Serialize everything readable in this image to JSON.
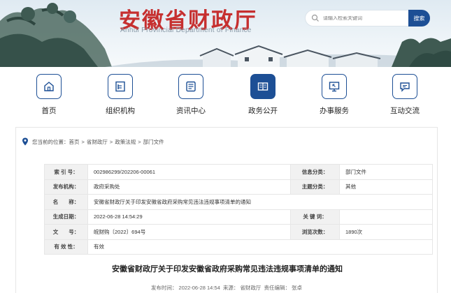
{
  "header": {
    "title": "安徽省财政厅",
    "subtitle": "Anhui Provincial Department of Finance",
    "search_placeholder": "请输入检索关键词",
    "search_button": "搜索"
  },
  "nav": {
    "items": [
      {
        "label": "首页",
        "icon": "home-icon",
        "active": false
      },
      {
        "label": "组织机构",
        "icon": "org-icon",
        "active": false
      },
      {
        "label": "资讯中心",
        "icon": "news-icon",
        "active": false
      },
      {
        "label": "政务公开",
        "icon": "book-icon",
        "active": true
      },
      {
        "label": "办事服务",
        "icon": "monitor-icon",
        "active": false
      },
      {
        "label": "互动交流",
        "icon": "chat-icon",
        "active": false
      }
    ]
  },
  "breadcrumb": {
    "prefix": "您当前的位置：",
    "items": [
      "首页",
      "省财政厅",
      "政策法规",
      "部门文件"
    ],
    "separator": ">"
  },
  "info": {
    "index_label": "索 引 号：",
    "index_value": "002986299/202206-00061",
    "category_label": "信息分类：",
    "category_value": "部门文件",
    "issuer_label": "发布机构：",
    "issuer_value": "政府采购处",
    "topic_label": "主题分类：",
    "topic_value": "其他",
    "name_label": "名　　称：",
    "name_value": "安徽省财政厅关于印发安徽省政府采购常见违法违规事项清单的通知",
    "date_label": "生成日期：",
    "date_value": "2022-06-28 14:54:29",
    "keyword_label": "关 键 词：",
    "keyword_value": "",
    "docno_label": "文　　号：",
    "docno_value": "皖财购〔2022〕694号",
    "views_label": "浏览次数：",
    "views_value": "1890次",
    "validity_label": "有 效 性：",
    "validity_value": "有效"
  },
  "article": {
    "title": "安徽省财政厅关于印发安徽省政府采购常见违法违规事项清单的通知",
    "publish_label": "发布时间：",
    "publish_value": "2022-06-28 14:54",
    "source_label": "来源：",
    "source_value": "省财政厅",
    "editor_label": "责任编辑：",
    "editor_value": "张卓"
  },
  "colors": {
    "brand_blue": "#1d4f95",
    "title_red": "#c62f2f"
  }
}
